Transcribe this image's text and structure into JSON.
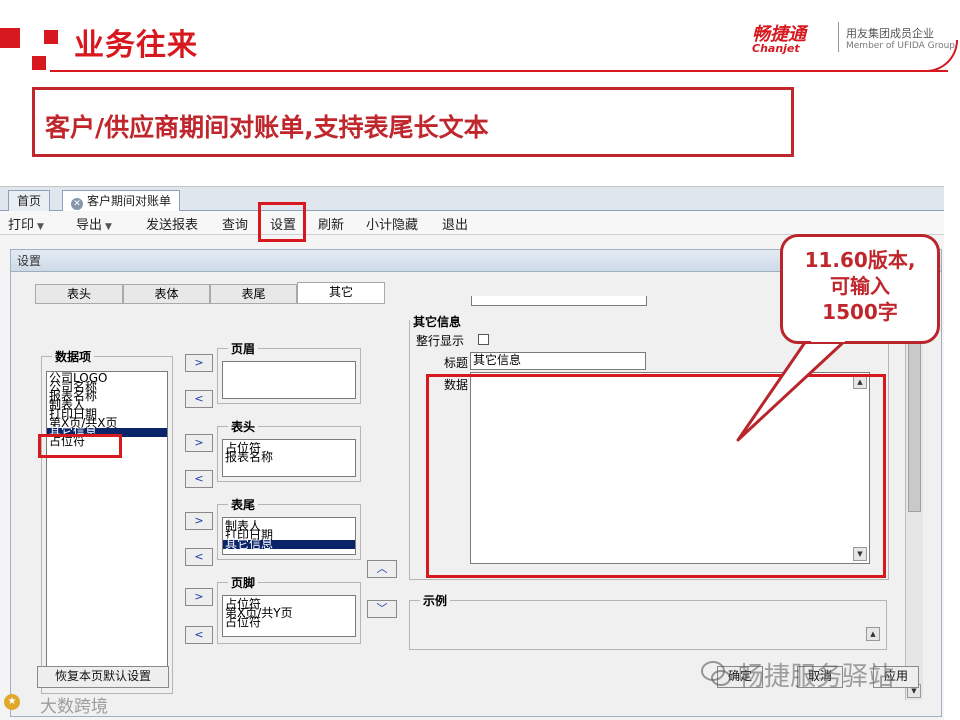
{
  "slide": {
    "title": "业务往来",
    "subtitle": "客户/供应商期间对账单,支持表尾长文本",
    "brand_cn": "畅捷通",
    "brand_en": "Chanjet",
    "brand_member_cn": "用友集团成员企业",
    "brand_member_en": "Member of UFIDA Group",
    "accent_color": "#d7191f"
  },
  "app": {
    "tabs": [
      {
        "label": "首页",
        "active": false
      },
      {
        "label": "客户期间对账单",
        "active": true
      }
    ],
    "toolbar": [
      {
        "label": "打印",
        "dropdown": true
      },
      {
        "label": "导出",
        "dropdown": true
      },
      {
        "label": "发送报表",
        "dropdown": false
      },
      {
        "label": "查询",
        "dropdown": false
      },
      {
        "label": "设置",
        "dropdown": false
      },
      {
        "label": "刷新",
        "dropdown": false
      },
      {
        "label": "小计隐藏",
        "dropdown": false
      },
      {
        "label": "退出",
        "dropdown": false
      }
    ]
  },
  "dialog": {
    "title": "设置",
    "tabs": [
      "表头",
      "表体",
      "表尾",
      "其它"
    ],
    "active_tab": "其它",
    "data_items_legend": "数据项",
    "data_items": [
      "公司LOGO",
      "公司名称",
      "报表名称",
      "制表人",
      "打印日期",
      "第X页/共X页",
      "其它信息",
      "占位符"
    ],
    "data_items_selected": "其它信息",
    "move_right": ">",
    "move_left": "<",
    "groups": [
      {
        "legend": "页眉",
        "items": []
      },
      {
        "legend": "表头",
        "items": [
          "占位符",
          "报表名称"
        ]
      },
      {
        "legend": "表尾",
        "items": [
          "制表人",
          "打印日期",
          "其它信息"
        ],
        "selected": "其它信息"
      },
      {
        "legend": "页脚",
        "items": [
          "占位符",
          "第X页/共Y页",
          "占位符"
        ]
      }
    ],
    "other_info": {
      "legend": "其它信息",
      "whole_row_label": "整行显示",
      "whole_row_checked": false,
      "title_label": "标题",
      "title_value": "其它信息",
      "data_label": "数据",
      "data_value": ""
    },
    "example_legend": "示例",
    "restore_default_button": "恢复本页默认设置",
    "ok_button": "确定",
    "cancel_button": "取消",
    "apply_button": "应用"
  },
  "callout": {
    "lines": [
      "11.60版本,",
      "可输入",
      "1500字"
    ]
  },
  "watermark": {
    "bottom_left": "大数跨境",
    "bottom_right": "畅捷服务驿站"
  }
}
